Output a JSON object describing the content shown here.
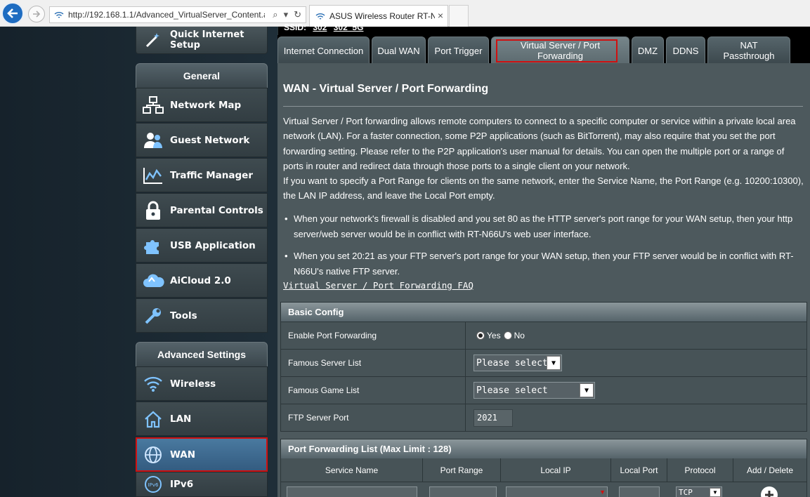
{
  "browser": {
    "url": "http://192.168.1.1/Advanced_VirtualServer_Content.asp",
    "tab_title": "ASUS Wireless Router RT-N...",
    "tab_close": "×"
  },
  "header": {
    "ssid_label": "SSID:",
    "ssid_values": [
      "302",
      "302_5G"
    ]
  },
  "sidebar": {
    "quick_setup": "Quick Internet Setup",
    "general_heading": "General",
    "general_items": [
      {
        "label": "Network Map",
        "icon": "network-map-icon"
      },
      {
        "label": "Guest Network",
        "icon": "guest-network-icon"
      },
      {
        "label": "Traffic Manager",
        "icon": "traffic-manager-icon"
      },
      {
        "label": "Parental Controls",
        "icon": "parental-controls-icon"
      },
      {
        "label": "USB Application",
        "icon": "usb-application-icon"
      },
      {
        "label": "AiCloud 2.0",
        "icon": "aicloud-icon"
      },
      {
        "label": "Tools",
        "icon": "tools-icon"
      }
    ],
    "advanced_heading": "Advanced Settings",
    "advanced_items": [
      {
        "label": "Wireless",
        "icon": "wireless-icon"
      },
      {
        "label": "LAN",
        "icon": "lan-icon"
      },
      {
        "label": "WAN",
        "icon": "wan-icon",
        "active": true
      },
      {
        "label": "IPv6",
        "icon": "ipv6-icon"
      }
    ]
  },
  "tabs": [
    {
      "label": "Internet Connection"
    },
    {
      "label": "Dual WAN"
    },
    {
      "label": "Port Trigger"
    },
    {
      "label": "Virtual Server / Port Forwarding",
      "active": true
    },
    {
      "label": "DMZ"
    },
    {
      "label": "DDNS"
    },
    {
      "label": "NAT Passthrough"
    }
  ],
  "main": {
    "title": "WAN - Virtual Server / Port Forwarding",
    "description": "Virtual Server / Port forwarding allows remote computers to connect to a specific computer or service within a private local area network (LAN). For a faster connection, some P2P applications (such as BitTorrent), may also require that you set the port forwarding setting. Please refer to the P2P application's user manual for details. You can open the multiple port or a range of ports in router and redirect data through those ports to a single client on your network.",
    "description2": "If you want to specify a Port Range for clients on the same network, enter the Service Name, the Port Range (e.g. 10200:10300), the LAN IP address, and leave the Local Port empty.",
    "bullets": [
      "When your network's firewall is disabled and you set 80 as the HTTP server's port range for your WAN setup, then your http server/web server would be in conflict with RT-N66U's web user interface.",
      "When you set 20:21 as your FTP server's port range for your WAN setup, then your FTP server would be in conflict with RT-N66U's native FTP server."
    ],
    "faq_link": "Virtual Server / Port Forwarding FAQ"
  },
  "basic_config": {
    "heading": "Basic Config",
    "enable_label": "Enable Port Forwarding",
    "yes_label": "Yes",
    "no_label": "No",
    "enabled": "Yes",
    "famous_server_label": "Famous Server List",
    "famous_server_value": "Please select",
    "famous_game_label": "Famous Game List",
    "famous_game_value": "Please select",
    "ftp_port_label": "FTP Server Port",
    "ftp_port_value": "2021"
  },
  "port_forwarding": {
    "heading": "Port Forwarding List (Max Limit : 128)",
    "columns": [
      "Service Name",
      "Port Range",
      "Local IP",
      "Local Port",
      "Protocol",
      "Add / Delete"
    ],
    "protocol_value": "TCP"
  },
  "colors": {
    "highlight_outline": "#d01010",
    "panel_bg": "#4d595d",
    "active_menu": "#3e6a91"
  }
}
